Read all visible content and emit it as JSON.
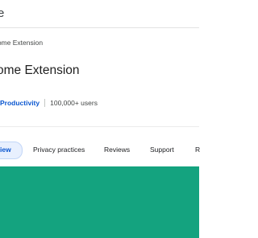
{
  "header": {
    "store_title": "e"
  },
  "breadcrumb": {
    "text": "rome Extension"
  },
  "extension": {
    "name": "ome Extension",
    "category": "Productivity",
    "users": "100,000+ users"
  },
  "tabs": [
    {
      "label": "iew",
      "active": true
    },
    {
      "label": "Privacy practices",
      "active": false
    },
    {
      "label": "Reviews",
      "active": false
    },
    {
      "label": "Support",
      "active": false
    },
    {
      "label": "R",
      "active": false
    }
  ],
  "colors": {
    "accent": "#0b57d0",
    "banner": "#14a37f",
    "tab_active_bg": "#e8f0fe"
  }
}
